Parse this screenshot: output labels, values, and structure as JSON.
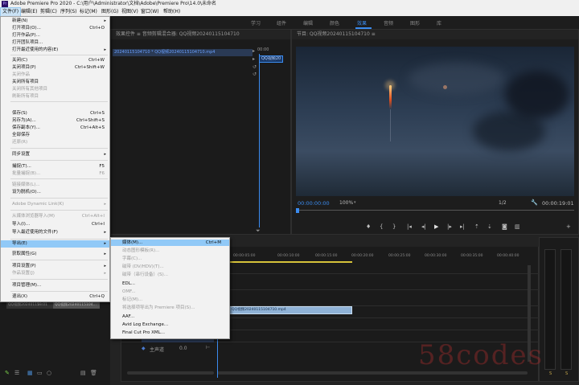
{
  "window": {
    "title": "Adobe Premiere Pro 2020 - C:\\用户\\Administrator\\文档\\Adobe\\Premiere Pro\\14.0\\未命名",
    "logo_text": "Pr"
  },
  "menubar": [
    "文件(F)",
    "编辑(E)",
    "剪辑(C)",
    "序列(S)",
    "标记(M)",
    "图形(G)",
    "视图(V)",
    "窗口(W)",
    "帮助(H)"
  ],
  "workspace_tabs": [
    "学习",
    "组件",
    "编辑",
    "颜色",
    "效果",
    "音频",
    "图形",
    "库"
  ],
  "workspace_active": "效果",
  "file_menu": {
    "items": [
      {
        "label": "新建(N)",
        "shortcut": "",
        "arrow": true,
        "disabled": false
      },
      {
        "label": "打开项目(O)...",
        "shortcut": "Ctrl+O",
        "arrow": false,
        "disabled": false
      },
      {
        "label": "打开作品(P)...",
        "shortcut": "",
        "arrow": false,
        "disabled": false
      },
      {
        "label": "打开团队项目...",
        "shortcut": "",
        "arrow": false,
        "disabled": false
      },
      {
        "label": "打开最近使用的内容(E)",
        "shortcut": "",
        "arrow": true,
        "disabled": false
      },
      {
        "label": "关闭(C)",
        "shortcut": "Ctrl+W",
        "arrow": false,
        "disabled": false
      },
      {
        "label": "关闭项目(P)",
        "shortcut": "Ctrl+Shift+W",
        "arrow": false,
        "disabled": false
      },
      {
        "label": "关闭作品",
        "shortcut": "",
        "arrow": false,
        "disabled": true
      },
      {
        "label": "关闭所有项目",
        "shortcut": "",
        "arrow": false,
        "disabled": false
      },
      {
        "label": "关闭所有其他项目",
        "shortcut": "",
        "arrow": false,
        "disabled": true
      },
      {
        "label": "刷新所有项目",
        "shortcut": "",
        "arrow": false,
        "disabled": true
      },
      {
        "label": "保存(S)",
        "shortcut": "Ctrl+S",
        "arrow": false,
        "disabled": false
      },
      {
        "label": "另存为(A)...",
        "shortcut": "Ctrl+Shift+S",
        "arrow": false,
        "disabled": false
      },
      {
        "label": "保存副本(Y)...",
        "shortcut": "Ctrl+Alt+S",
        "arrow": false,
        "disabled": false
      },
      {
        "label": "全部保存",
        "shortcut": "",
        "arrow": false,
        "disabled": false
      },
      {
        "label": "还原(R)",
        "shortcut": "",
        "arrow": false,
        "disabled": true
      },
      {
        "label": "同步设置",
        "shortcut": "",
        "arrow": true,
        "disabled": false
      },
      {
        "label": "捕捉(T)...",
        "shortcut": "F5",
        "arrow": false,
        "disabled": false
      },
      {
        "label": "批量捕捉(B)...",
        "shortcut": "F6",
        "arrow": false,
        "disabled": true
      },
      {
        "label": "链接媒体(L)...",
        "shortcut": "",
        "arrow": false,
        "disabled": true
      },
      {
        "label": "设为脱机(O)...",
        "shortcut": "",
        "arrow": false,
        "disabled": false
      },
      {
        "label": "Adobe Dynamic Link(K)",
        "shortcut": "",
        "arrow": true,
        "disabled": true
      },
      {
        "label": "从媒体浏览器导入(M)",
        "shortcut": "Ctrl+Alt+I",
        "arrow": false,
        "disabled": true
      },
      {
        "label": "导入(I)...",
        "shortcut": "Ctrl+I",
        "arrow": false,
        "disabled": false
      },
      {
        "label": "导入最近使用的文件(F)",
        "shortcut": "",
        "arrow": true,
        "disabled": false
      },
      {
        "label": "导出(E)",
        "shortcut": "",
        "arrow": true,
        "disabled": false,
        "highlight": true
      },
      {
        "label": "获取属性(G)",
        "shortcut": "",
        "arrow": true,
        "disabled": false
      },
      {
        "label": "项目设置(P)",
        "shortcut": "",
        "arrow": true,
        "disabled": false
      },
      {
        "label": "作品设置(J)",
        "shortcut": "",
        "arrow": true,
        "disabled": true
      },
      {
        "label": "项目管理(M)...",
        "shortcut": "",
        "arrow": false,
        "disabled": false
      },
      {
        "label": "退出(X)",
        "shortcut": "Ctrl+Q",
        "arrow": false,
        "disabled": false
      }
    ]
  },
  "export_submenu": {
    "items": [
      {
        "label": "媒体(M)...",
        "shortcut": "Ctrl+M",
        "disabled": false,
        "highlight": true
      },
      {
        "label": "动态图形模板(R)...",
        "shortcut": "",
        "disabled": true
      },
      {
        "label": "字幕(C)...",
        "shortcut": "",
        "disabled": true
      },
      {
        "label": "磁带 (DV/HDV)(T)...",
        "shortcut": "",
        "disabled": true
      },
      {
        "label": "磁带（串行设备）(S)...",
        "shortcut": "",
        "disabled": true
      },
      {
        "label": "EDL...",
        "shortcut": "",
        "disabled": false
      },
      {
        "label": "OMF...",
        "shortcut": "",
        "disabled": true
      },
      {
        "label": "标记(M)...",
        "shortcut": "",
        "disabled": true
      },
      {
        "label": "将选择项导出为 Premiere 项目(S)...",
        "shortcut": "",
        "disabled": true
      },
      {
        "label": "AAF...",
        "shortcut": "",
        "disabled": false
      },
      {
        "label": "Avid Log Exchange...",
        "shortcut": "",
        "disabled": false
      },
      {
        "label": "Final Cut Pro XML...",
        "shortcut": "",
        "disabled": false
      }
    ]
  },
  "source_panel": {
    "title": "效果控件 ≡   音频剪辑混合器: QQ视频20240115104710",
    "clip_name": "20240115104710 * QQ视频20240115104710.mp4",
    "timecode": "00:00",
    "clip_chip": "QQ视频20"
  },
  "program_monitor": {
    "title": "节目: QQ视频20240115104710 ≡",
    "timecode_current": "00:00:00:00",
    "zoom": "100%",
    "resolution": "1/2",
    "timecode_duration": "00:00:19:01"
  },
  "timeline": {
    "ruler": [
      "00:00",
      "00:00:05:00",
      "00:00:10:00",
      "00:00:15:00",
      "00:00:20:00",
      "00:00:25:00",
      "00:00:30:00",
      "00:00:35:00",
      "00:00:40:00"
    ],
    "clip_label": "QQ视频20240115104710.mp4",
    "master_label": "主声道",
    "master_value": "0.0"
  },
  "project_panel": {
    "thumb_label": "QQ视频20240115...",
    "thumb_duration": "19:01",
    "item_label": "QQ视频20240115104..."
  },
  "watermark": "58codes"
}
